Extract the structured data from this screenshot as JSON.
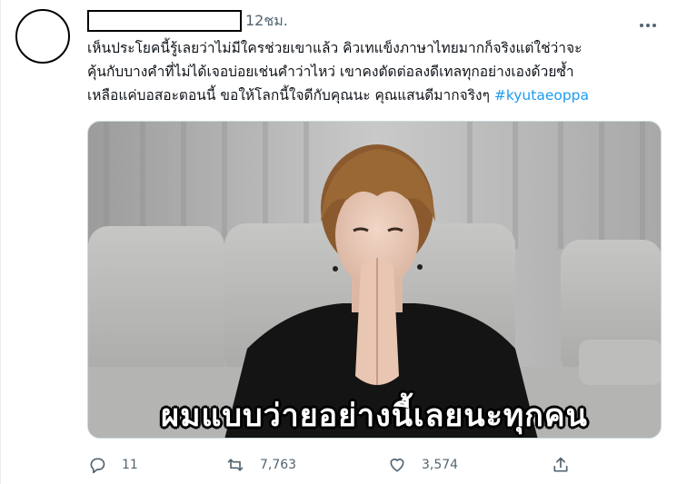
{
  "tweet": {
    "timestamp": "12ชม.",
    "text_lines": [
      "เห็นประโยคนี้รู้เลยว่าไม่มีใครช่วยเขาแล้ว คิวเทแข็งภาษาไทยมากก็จริงแต่ใช่ว่าจะ",
      "คุ้นกับบางคำที่ไม่ได้เจอบ่อยเช่นคำว่าไหว่ เขาคงตัดต่อลงดีเทลทุกอย่างเองด้วยซ้ำ",
      "เหลือแค่บอสอะตอนนี้  ขอให้โลกนี้ใจดีกับคุณนะ คุณแสนดีมากจริงๆ "
    ],
    "hashtag": "#kyutaeoppa",
    "video_subtitle": "ผมแบบว่ายอย่างนี้เลยนะทุกคน"
  },
  "actions": {
    "reply_count": "11",
    "retweet_count": "7,763",
    "like_count": "3,574"
  },
  "colors": {
    "accent": "#1d9bf0",
    "muted": "#536471"
  },
  "icons": {
    "more": "more-icon",
    "reply": "reply-icon",
    "retweet": "retweet-icon",
    "like": "heart-icon",
    "share": "share-icon"
  }
}
